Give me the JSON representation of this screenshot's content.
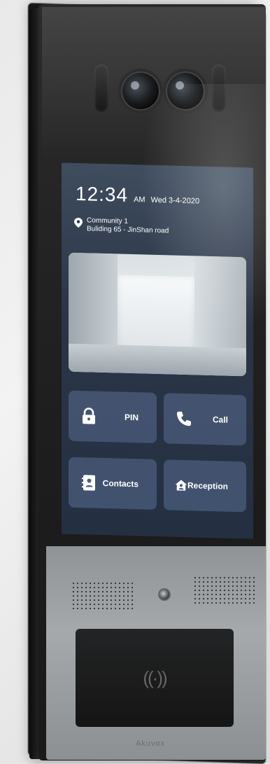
{
  "status": {
    "time": "12:34",
    "ampm": "AM",
    "date": "Wed 3-4-2020"
  },
  "location": {
    "line1": "Community 1",
    "line2": "Buliding 65 - JinShan road"
  },
  "tiles": {
    "pin": "PIN",
    "call": "Call",
    "contacts": "Contacts",
    "reception": "Reception"
  },
  "icons": {
    "location": "map-pin-icon",
    "pin": "lock-icon",
    "call": "phone-icon",
    "contacts": "contact-book-icon",
    "reception": "home-user-icon",
    "rfid": "rfid-icon"
  },
  "device": {
    "rfid_symbol": "((·))",
    "brand": "Akuvox"
  },
  "colors": {
    "screen_bg": "#2b3547",
    "tile_bg": "#5a6e91",
    "device_body": "#1d1d1d",
    "metal_panel": "#a5a9ac"
  }
}
